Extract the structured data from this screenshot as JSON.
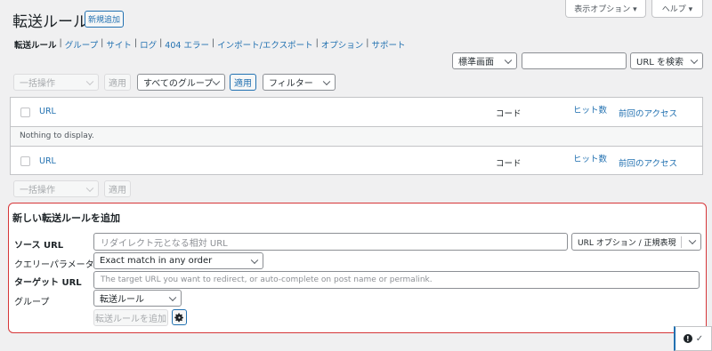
{
  "header": {
    "title": "転送ルール",
    "add_new": "新規追加",
    "screen_options": "表示オプション ▾",
    "help": "ヘルプ ▾"
  },
  "subnav": {
    "items": [
      "転送ルール",
      "グループ",
      "サイト",
      "ログ",
      "404 エラー",
      "インポート/エクスポート",
      "オプション",
      "サポート"
    ]
  },
  "search": {
    "mode": "標準画面",
    "placeholder": "",
    "button": "URL を検索"
  },
  "toolbar_top": {
    "bulk": "一括操作",
    "apply": "適用",
    "groups": "すべてのグループ",
    "apply2": "適用",
    "filter": "フィルター"
  },
  "table": {
    "col_url": "URL",
    "col_code": "コード",
    "col_hits": "ヒット数",
    "col_last": "前回のアクセス",
    "empty": "Nothing to display."
  },
  "toolbar_bottom": {
    "bulk": "一括操作",
    "apply": "適用"
  },
  "add_form": {
    "heading": "新しい転送ルールを追加",
    "source_label": "ソース URL",
    "source_placeholder": "リダイレクト元となる相対 URL",
    "url_options": "URL オプション / 正規表現",
    "query_label": "クエリーパラメータ",
    "query_value": "Exact match in any order",
    "target_label": "ターゲット URL",
    "target_placeholder": "The target URL you want to redirect, or auto-complete on post name or permalink.",
    "group_label": "グループ",
    "group_value": "転送ルール",
    "submit": "転送ルールを追加"
  },
  "colors": {
    "accent": "#2271b1",
    "highlight_border": "#d63638"
  }
}
